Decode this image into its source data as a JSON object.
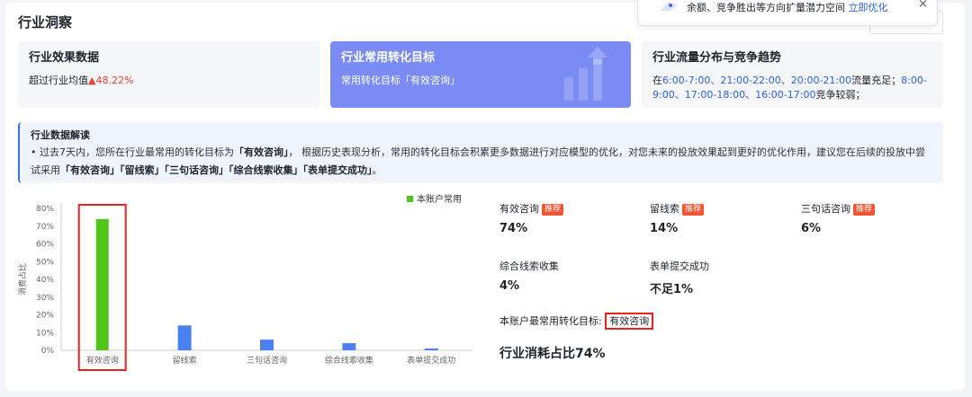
{
  "page_title": "行业洞察",
  "notice": {
    "text": "余额、竞争胜出等方向扩量潜力空间",
    "link": "立即优化",
    "close": "×"
  },
  "cards": {
    "efficiency": {
      "title": "行业效果数据",
      "text": "超过行业均值",
      "value": "▲48.22%"
    },
    "conversion": {
      "title": "行业常用转化目标",
      "text": "常用转化目标「有效咨询」"
    },
    "traffic": {
      "title": "行业流量分布与竞争趋势",
      "prefix": "在",
      "strong": "6:00-7:00、21:00-22:00、20:00-21:00",
      "mid": "流量充足；",
      "weak": "8:00-9:00、17:00-18:00、16:00-17:00",
      "suffix": "竞争较弱；"
    }
  },
  "interpretation": {
    "title": "行业数据解读",
    "p1": "• 过去7天内，您所在行业最常用的转化目标为",
    "goal": "「有效咨询」",
    "p2": "， 根据历史表现分析，常用的转化目标会积累更多数据进行对应模型的优化，对您未来的投放效果起到更好的优化作用，建议您在后续的投放中尝试采用",
    "list": "「有效咨询」「留线索」「三句话咨询」「综合线索收集」「表单提交成功」",
    "end": "。"
  },
  "chart_data": {
    "type": "bar",
    "categories": [
      "有效咨询",
      "留线索",
      "三句话咨询",
      "综合线索收集",
      "表单提交成功"
    ],
    "values": [
      74,
      14,
      6,
      4,
      1
    ],
    "highlight_index": 0,
    "ylabel": "消费占比",
    "ylim": [
      0,
      80
    ],
    "yticks": [
      "0%",
      "10%",
      "20%",
      "30%",
      "40%",
      "50%",
      "60%",
      "70%",
      "80%"
    ],
    "legend": "本账户常用",
    "legend_position": "top-right",
    "colors": {
      "highlight": "#52c41a",
      "normal": "#4a80f0",
      "axis": "#cccccc"
    }
  },
  "stats": [
    {
      "label": "有效咨询",
      "tag": "推荐",
      "value": "74%"
    },
    {
      "label": "留线索",
      "tag": "推荐",
      "value": "14%"
    },
    {
      "label": "三句话咨询",
      "tag": "推荐",
      "value": "6%"
    },
    {
      "label": "综合线索收集",
      "tag": "",
      "value": "4%"
    },
    {
      "label": "表单提交成功",
      "tag": "",
      "value": "不足1%"
    }
  ],
  "account_common": {
    "label": "本账户最常用转化目标:",
    "value": "有效咨询"
  },
  "industry_share": "行业消耗占比74%"
}
